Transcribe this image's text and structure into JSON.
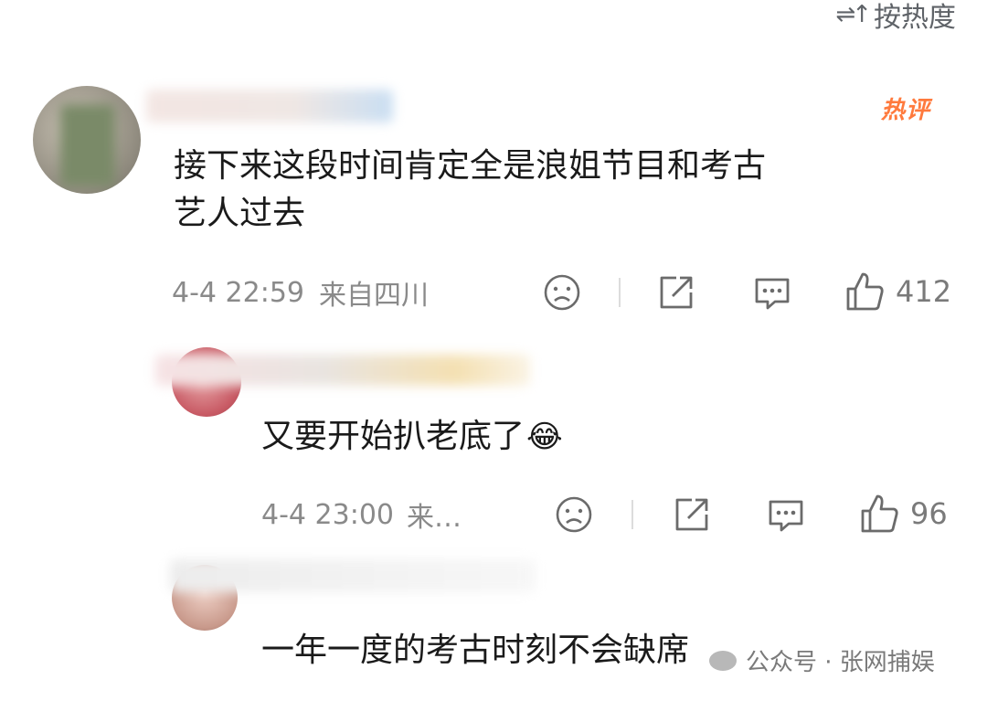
{
  "sort": {
    "label": "按热度",
    "icon": "sort-icon"
  },
  "comments": [
    {
      "hot_badge": "热评",
      "content_line1": "接下来这段时间肯定全是浪姐节目和考古",
      "content_line2": "艺人过去",
      "time": "4-4 22:59",
      "location": "来自四川",
      "likes": "412"
    },
    {
      "content": "又要开始扒老底了",
      "emoji": "😂",
      "time": "4-4 23:00",
      "location": "来…",
      "likes": "96"
    },
    {
      "content": "一年一度的考古时刻不会缺席"
    }
  ],
  "watermark": {
    "text": "公众号 · 张网捕娱"
  },
  "colors": {
    "text": "#1a1a1a",
    "meta": "#8a8a8a",
    "hot": "#ff7a3d"
  }
}
